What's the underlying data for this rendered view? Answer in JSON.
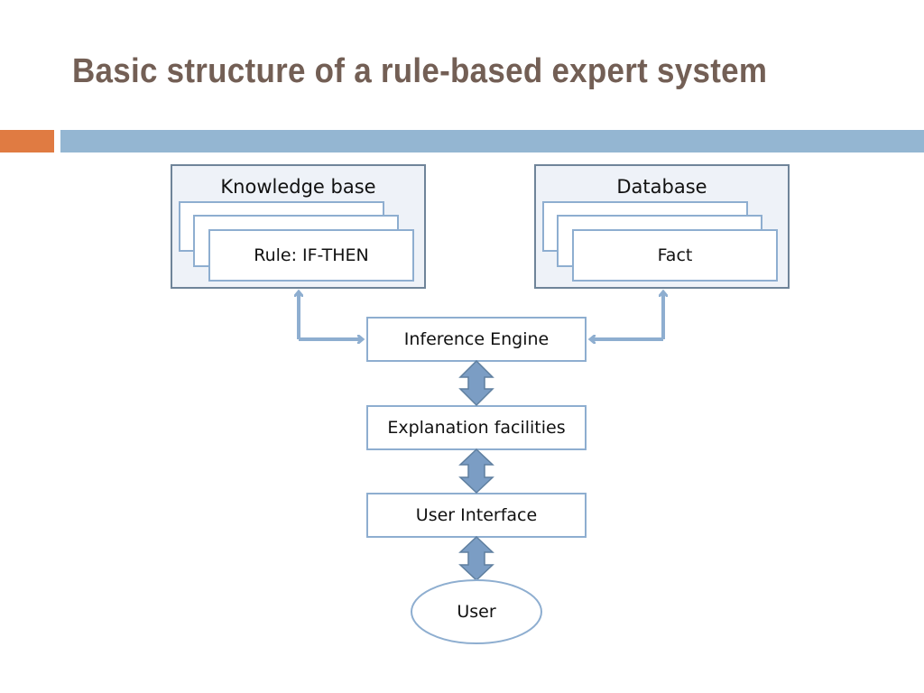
{
  "slide": {
    "title": "Basic structure of a rule-based expert system",
    "colors": {
      "title": "#735f55",
      "accent_orange": "#e07b42",
      "accent_blue": "#94b6d2",
      "box_border": "#8eaed0",
      "container_border": "#6f8499",
      "container_fill": "#eef2f8",
      "arrow_fill": "#7b9dc4",
      "arrow_stroke": "#5f7f9f"
    }
  },
  "diagram": {
    "knowledge_base": {
      "label": "Knowledge base",
      "item": "Rule: IF-THEN"
    },
    "database": {
      "label": "Database",
      "item": "Fact"
    },
    "inference_engine": {
      "label": "Inference Engine"
    },
    "explanation_facilities": {
      "label": "Explanation facilities"
    },
    "user_interface": {
      "label": "User Interface"
    },
    "user": {
      "label": "User"
    }
  }
}
